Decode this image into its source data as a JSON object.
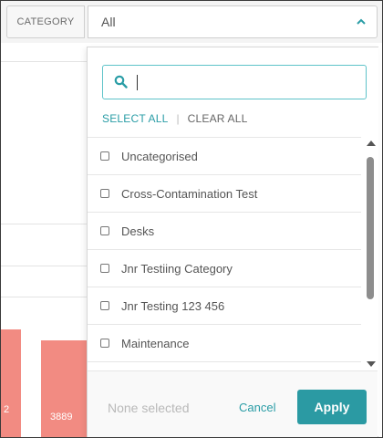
{
  "filter": {
    "category_label": "CATEGORY",
    "selected_value": "All",
    "chevron_icon": "chevron-up-icon"
  },
  "background": {
    "bar_labels": [
      "2",
      "3889"
    ],
    "bar_color": "#f28b82"
  },
  "dropdown": {
    "search": {
      "value": "",
      "placeholder": "",
      "icon": "search-icon"
    },
    "select_all": "SELECT ALL",
    "clear_all": "CLEAR ALL",
    "items": [
      {
        "label": "Uncategorised",
        "checked": false
      },
      {
        "label": "Cross-Contamination Test",
        "checked": false
      },
      {
        "label": "Desks",
        "checked": false
      },
      {
        "label": "Jnr Testiing Category",
        "checked": false
      },
      {
        "label": "Jnr Testing 123 456",
        "checked": false
      },
      {
        "label": "Maintenance",
        "checked": false
      }
    ],
    "status_text": "None selected",
    "cancel_label": "Cancel",
    "apply_label": "Apply"
  },
  "colors": {
    "accent": "#2b9aa3",
    "search_border": "#5ec3c9"
  }
}
